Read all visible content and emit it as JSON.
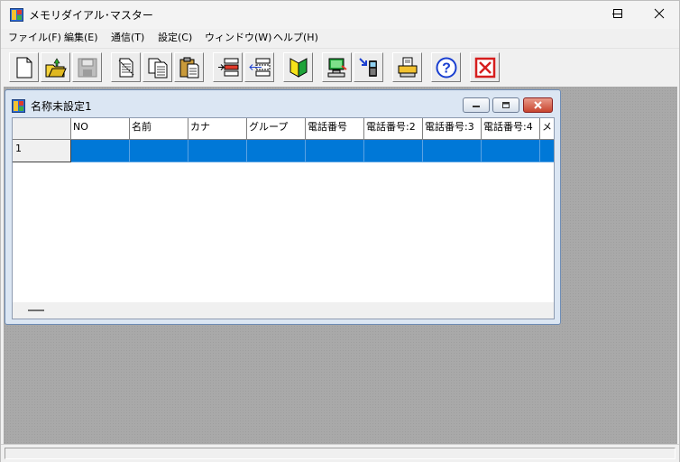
{
  "window": {
    "title": "メモリダイアル･マスター"
  },
  "window_controls": {
    "minimize": "minimize-icon",
    "maximize": "maximize-icon",
    "close": "close-icon"
  },
  "menu": [
    "ファイル(F)",
    "編集(E)",
    "通信(T)",
    "設定(C)",
    "ウィンドウ(W)",
    "ヘルプ(H)"
  ],
  "toolbar_icons": [
    "new-document-icon",
    "open-folder-icon",
    "save-disk-icon",
    "cut-icon",
    "copy-icon",
    "paste-icon",
    "insert-row-icon",
    "delete-row-icon",
    "beginner-mark-icon",
    "send-to-phone-icon",
    "receive-from-phone-icon",
    "print-icon",
    "help-icon",
    "exit-icon"
  ],
  "child_window": {
    "title": "名称未設定1",
    "columns": [
      "NO",
      "名前",
      "カナ",
      "グループ",
      "電話番号",
      "電話番号:2",
      "電話番号:3",
      "電話番号:4",
      "メ"
    ],
    "rows": [
      {
        "number": "1"
      }
    ]
  },
  "colors": {
    "selection": "#0078d7",
    "mdi_background": "#a9a9a9",
    "child_frame": "#dbe6f3"
  }
}
